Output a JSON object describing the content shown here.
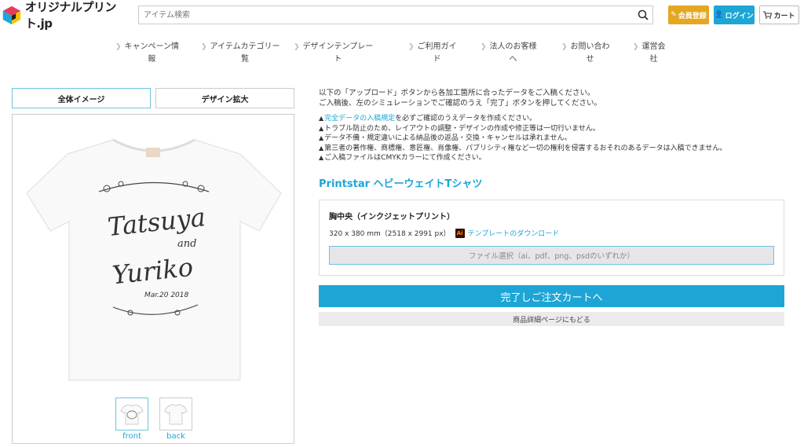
{
  "header": {
    "logo_text": "オリジナルプリント.jp",
    "search_placeholder": "アイテム検索",
    "member_label": "会員登録",
    "login_label": "ログイン",
    "cart_label": "カート",
    "member_color": "#e4a722",
    "login_color": "#1da6d5"
  },
  "nav": {
    "items": [
      {
        "line1": "キャンペーン情",
        "line2": "報"
      },
      {
        "line1": "アイテムカテゴリー",
        "line2": "覧"
      },
      {
        "line1": "デザインテンプレー",
        "line2": "ト"
      },
      {
        "line1": "ご利用ガイ",
        "line2": "ド"
      },
      {
        "line1": "法人のお客様",
        "line2": "へ"
      },
      {
        "line1": "お問い合わ",
        "line2": "せ"
      },
      {
        "line1": "運営会",
        "line2": "社"
      }
    ]
  },
  "preview": {
    "tab_full": "全体イメージ",
    "tab_zoom": "デザイン拡大",
    "design_line1": "Tatsuya",
    "design_and": "and",
    "design_line2": "Yuriko",
    "design_date": "Mar.20 2018",
    "thumb_front": "front",
    "thumb_back": "back"
  },
  "intro": {
    "line1": "以下の「アップロード」ボタンから各加工箇所に合ったデータをご入稿ください。",
    "line2": "ご入稿後、左のシミュレーションでご確認のうえ「完了」ボタンを押してください。"
  },
  "notes": {
    "n1_link": "完全データの入稿規定",
    "n1_rest": "を必ずご確認のうえデータを作成ください。",
    "n2": "トラブル防止のため、レイアウトの調整・デザインの作成や修正等は一切行いません。",
    "n3": "データ不備・規定違いによる納品後の返品・交換・キャンセルは承れません。",
    "n4": "第三者の著作権、商標権、意匠権、肖像権、パブリシティ権など一切の権利を侵害するおそれのあるデータは入稿できません。",
    "n5": "ご入稿ファイルはCMYKカラーにて作成ください。"
  },
  "product": {
    "title": "Printstar ヘビーウェイトTシャツ",
    "print_location": "胸中央（インクジェットプリント）",
    "size_text": "320 x 380 mm（2518 x 2991 px）",
    "ai_icon_text": "Ai",
    "template_link": "テンプレートのダウンロード",
    "file_select": "ファイル選択（ai、pdf、png、psdのいずれか）",
    "cart_button": "完了しご注文カートへ",
    "back_button": "商品詳細ページにもどる",
    "accent_color": "#1da6d5"
  }
}
